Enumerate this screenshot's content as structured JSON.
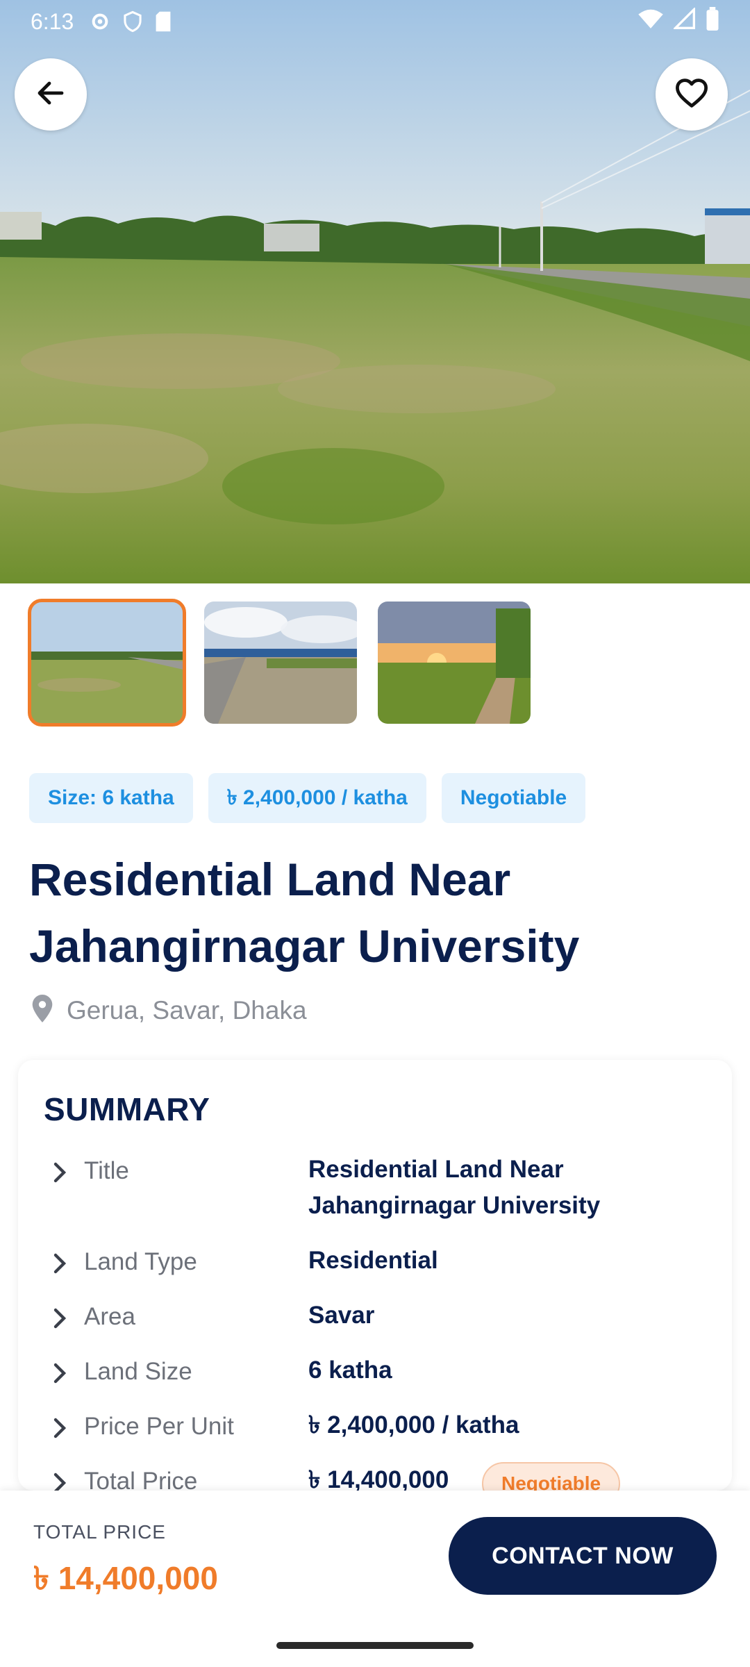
{
  "status_bar": {
    "time": "6:13",
    "icons_left": [
      "settings-icon",
      "shield-icon",
      "sd-card-icon"
    ],
    "icons_right": [
      "wifi-icon",
      "signal-icon",
      "battery-icon"
    ]
  },
  "hero": {
    "back_icon": "arrow-left-icon",
    "favorite_icon": "heart-outline-icon"
  },
  "gallery": {
    "selected_index": 0,
    "count": 3
  },
  "chips": [
    "Size: 6 katha",
    "৳ 2,400,000 / katha",
    "Negotiable"
  ],
  "listing": {
    "title": "Residential Land Near Jahangirnagar University",
    "location": "Gerua, Savar, Dhaka"
  },
  "summary": {
    "heading": "SUMMARY",
    "rows": [
      {
        "label": "Title",
        "value": "Residential Land Near Jahangirnagar University"
      },
      {
        "label": "Land Type",
        "value": "Residential"
      },
      {
        "label": "Area",
        "value": "Savar"
      },
      {
        "label": "Land Size",
        "value": "6 katha"
      },
      {
        "label": "Price Per Unit",
        "value": "৳ 2,400,000 / katha"
      },
      {
        "label": "Total Price",
        "value": "৳ 14,400,000",
        "badge": "Negotiable"
      }
    ]
  },
  "bottom_bar": {
    "total_label": "TOTAL PRICE",
    "total_value": "৳ 14,400,000",
    "cta_label": "CONTACT NOW"
  },
  "colors": {
    "navy": "#0b1f4d",
    "orange": "#f07c2a",
    "chip_bg": "#e6f3fd",
    "chip_text": "#1d8fe0"
  }
}
